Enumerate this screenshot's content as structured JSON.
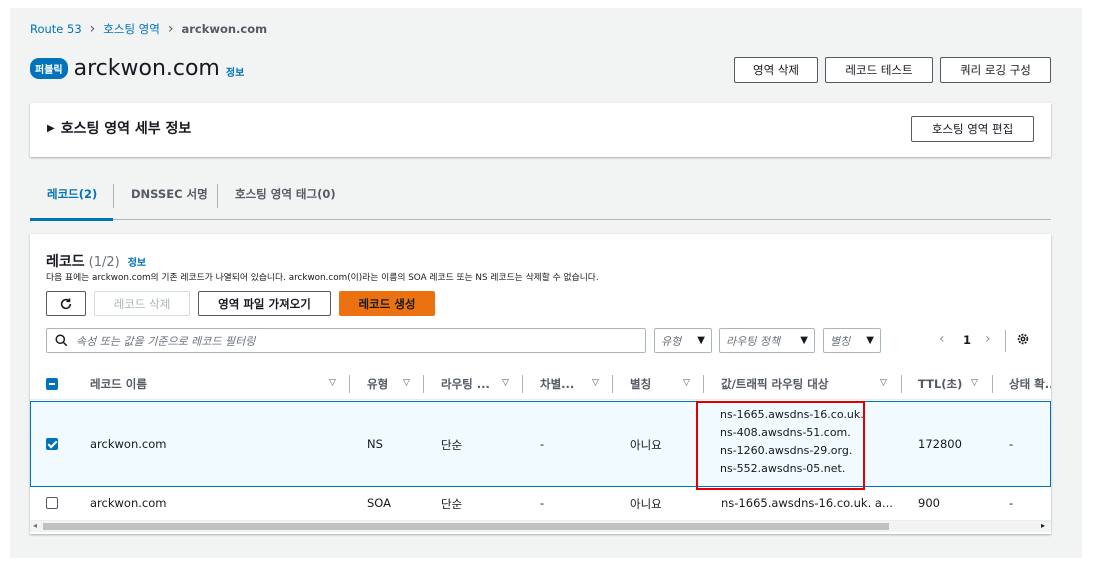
{
  "breadcrumb": {
    "root": "Route 53",
    "middle": "호스팅 영역",
    "current": "arckwon.com"
  },
  "header": {
    "badge": "퍼블릭",
    "title": "arckwon.com",
    "info": "정보"
  },
  "actions": {
    "delete_zone": "영역 삭제",
    "test_record": "레코드 테스트",
    "query_logging": "쿼리 로깅 구성"
  },
  "details": {
    "title": "호스팅 영역 세부 정보",
    "edit": "호스팅 영역 편집"
  },
  "tabs": [
    {
      "label": "레코드(2)"
    },
    {
      "label": "DNSSEC 서명"
    },
    {
      "label": "호스팅 영역 태그(0)"
    }
  ],
  "records": {
    "title": "레코드",
    "count": "(1/2)",
    "info": "정보",
    "description": "다음 표에는 arckwon.com의 기존 레코드가 나열되어 있습니다. arckwon.com(이)라는 이름의 SOA 레코드 또는 NS 레코드는 삭제할 수 없습니다.",
    "delete_label": "레코드 삭제",
    "import_label": "영역 파일 가져오기",
    "create_label": "레코드 생성",
    "search_placeholder": "속성 또는 값을 기준으로 레코드 필터링",
    "filter_type": "유형",
    "filter_routing": "라우팅 정책",
    "filter_alias": "별칭",
    "page": "1"
  },
  "columns": [
    "레코드 이름",
    "유형",
    "라우팅 ...",
    "차별...",
    "별칭",
    "값/트래픽 라우팅 대상",
    "TTL(초)",
    "상태 확..."
  ],
  "rows": [
    {
      "name": "arckwon.com",
      "type": "NS",
      "routing": "단순",
      "diff": "-",
      "alias": "아니요",
      "values": [
        "ns-1665.awsdns-16.co.uk.",
        "ns-408.awsdns-51.com.",
        "ns-1260.awsdns-29.org.",
        "ns-552.awsdns-05.net."
      ],
      "ttl": "172800",
      "health": "-",
      "checked": true
    },
    {
      "name": "arckwon.com",
      "type": "SOA",
      "routing": "단순",
      "diff": "-",
      "alias": "아니요",
      "value": "ns-1665.awsdns-16.co.uk. a...",
      "ttl": "900",
      "health": "-",
      "checked": false
    }
  ],
  "colors": {
    "link": "#0073bb",
    "primary": "#ec7211",
    "highlight": "#e00000"
  }
}
